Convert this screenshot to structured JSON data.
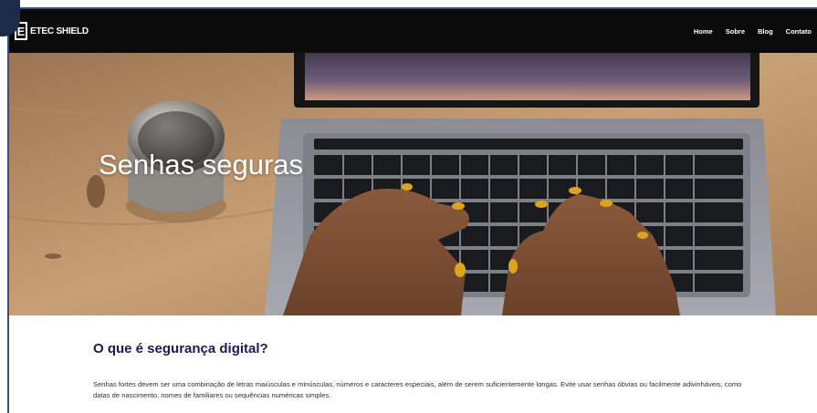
{
  "brand": {
    "mark": "E",
    "name": "ETEC SHIELD"
  },
  "nav": {
    "items": [
      "Home",
      "Sobre",
      "Blog",
      "Contato"
    ]
  },
  "hero": {
    "title": "Senhas seguras"
  },
  "section": {
    "title": "O que é segurança digital?",
    "body": "Senhas fortes devem ser uma combinação de letras maiúsculas e minúsculas, números e caracteres especiais, além de serem suficientemente longas. Evite usar senhas óbvias ou facilmente adivinháveis, como datas de nascimento, nomes de familiares ou sequências numéricas simples."
  },
  "colors": {
    "navbar": "#0b0b0b",
    "heading": "#1c1a57",
    "nail_polish": "#e0a41c"
  }
}
